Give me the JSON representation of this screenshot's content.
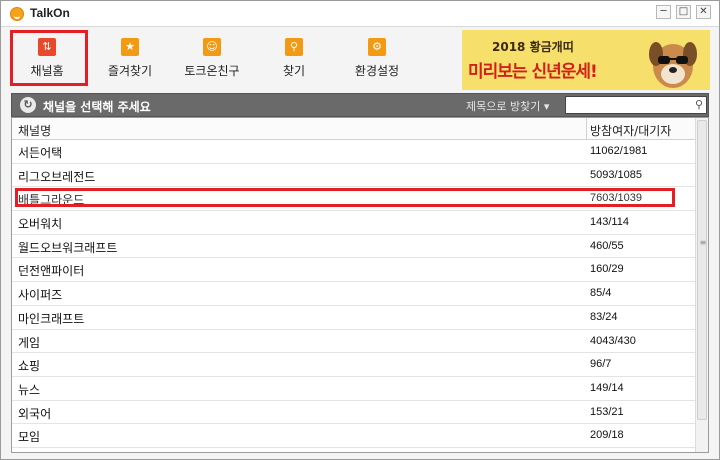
{
  "window": {
    "title": "TalkOn",
    "minimize": "─",
    "maximize": "□",
    "close": "✕"
  },
  "toolbar": {
    "items": [
      {
        "label": "채널홈",
        "icon": "channel-home-icon",
        "color": "#e8492a"
      },
      {
        "label": "즐겨찾기",
        "icon": "star-icon",
        "color": "#f39a14"
      },
      {
        "label": "토크온친구",
        "icon": "smiley-icon",
        "color": "#f39a14"
      },
      {
        "label": "찾기",
        "icon": "magnifier-icon",
        "color": "#f39a14"
      },
      {
        "label": "환경설정",
        "icon": "gear-icon",
        "color": "#f39a14"
      }
    ]
  },
  "banner": {
    "line1": "2018 황금개띠",
    "line2": "미리보는 신년운세!"
  },
  "search": {
    "title": "채널을 선택해 주세요",
    "sort_label": "제목으로 방찾기 ▾",
    "placeholder": "",
    "value": ""
  },
  "table": {
    "col_name": "채널명",
    "col_count": "방참여자/대기자",
    "rows": [
      {
        "name": "서든어택",
        "count": "11062/1981"
      },
      {
        "name": "리그오브레전드",
        "count": "5093/1085"
      },
      {
        "name": "배틀그라운드",
        "count": "7603/1039"
      },
      {
        "name": "오버워치",
        "count": "143/114"
      },
      {
        "name": "월드오브워크래프트",
        "count": "460/55"
      },
      {
        "name": "던전앤파이터",
        "count": "160/29"
      },
      {
        "name": "사이퍼즈",
        "count": "85/4"
      },
      {
        "name": "마인크래프트",
        "count": "83/24"
      },
      {
        "name": "게임",
        "count": "4043/430"
      },
      {
        "name": "쇼핑",
        "count": "96/7"
      },
      {
        "name": "뉴스",
        "count": "149/14"
      },
      {
        "name": "외국어",
        "count": "153/21"
      },
      {
        "name": "모임",
        "count": "209/18"
      }
    ]
  },
  "colors": {
    "highlight": "#e31e24",
    "accent": "#f39a14"
  }
}
